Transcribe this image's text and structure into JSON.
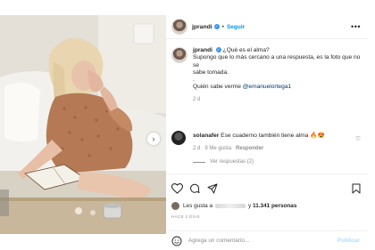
{
  "post": {
    "username": "jprandi",
    "follow_label": "Seguir",
    "separator": "•",
    "more_glyph": "•••",
    "verified_glyph": "✓"
  },
  "caption": {
    "username": "jprandi",
    "lines": [
      "¿Qué es el alma?",
      "Supongo que lo más cercano a una respuesta, es la foto que no se",
      "sabe tomada."
    ],
    "dot_line": ".",
    "quote_prefix": "Quién sabe verme ",
    "mention": "@emanuelortega1",
    "time": "2 d"
  },
  "comment": {
    "username": "solanafer",
    "text": "Ese cuaderno también tiene alma 🔥😍",
    "time": "2 d",
    "likes": "9 Me gusta",
    "reply_label": "Responder",
    "view_replies": "Ver respuestas (2)",
    "heart_glyph": "♡"
  },
  "likes": {
    "prefix": "Les gusta a",
    "connector": "y",
    "count": "11.341 personas"
  },
  "post_date": "HACE 2 DÍAS",
  "comment_box": {
    "placeholder": "Agrega un comentario...",
    "publish_label": "Publicar"
  },
  "icons": {
    "like": "heart-icon",
    "comment": "comment-bubble-icon",
    "share": "paper-plane-icon",
    "save": "bookmark-icon",
    "emoji": "smiley-icon",
    "next": "chevron-right-icon"
  },
  "colors": {
    "accent": "#0095f6",
    "verified": "#3897f0",
    "muted": "#8e8e8e",
    "publish_disabled": "#b3dbff",
    "mention": "#00376b"
  }
}
